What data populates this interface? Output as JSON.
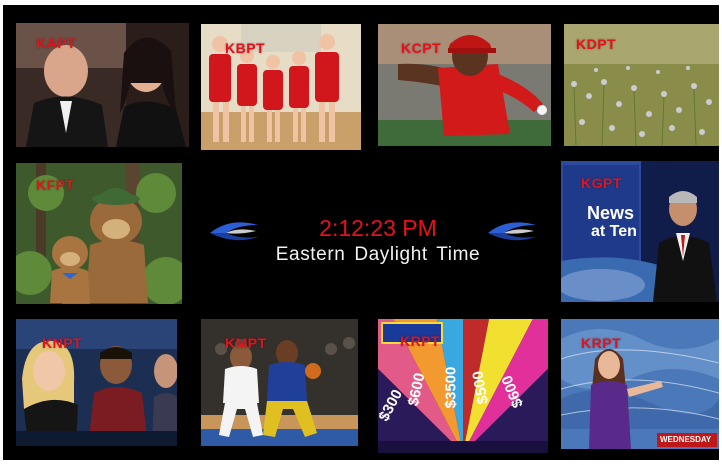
{
  "clock": {
    "time": "2:12:23 PM",
    "timezone": "Eastern Daylight Time",
    "time_color": "#e8101a"
  },
  "channels": [
    {
      "call_sign": "KAPT",
      "thumbnail": "couple-at-event"
    },
    {
      "call_sign": "KBPT",
      "thumbnail": "wrestling-team"
    },
    {
      "call_sign": "KCPT",
      "thumbnail": "baseball-pitcher"
    },
    {
      "call_sign": "KDPT",
      "thumbnail": "wildflower-field"
    },
    {
      "call_sign": "KFPT",
      "thumbnail": "cartoon-bears-forest"
    },
    {
      "call_sign": "KGPT",
      "thumbnail": "news-anchor",
      "overlay": {
        "line1": "News",
        "line2": "at Ten"
      }
    },
    {
      "call_sign": "KNPT",
      "thumbnail": "tv-comedy-cast"
    },
    {
      "call_sign": "KMPT",
      "thumbnail": "basketball-game"
    },
    {
      "call_sign": "KRPT",
      "thumbnail": "game-show-wheel",
      "wheel_values": [
        "$300",
        "$600",
        "$3500",
        "$500",
        "$600"
      ]
    },
    {
      "call_sign": "KRPT",
      "thumbnail": "weather-forecaster",
      "overlay": {
        "badge": "WEDNESDAY"
      }
    }
  ],
  "label_color": "#e8101a",
  "logo_icon": "blue-swoosh-logo"
}
